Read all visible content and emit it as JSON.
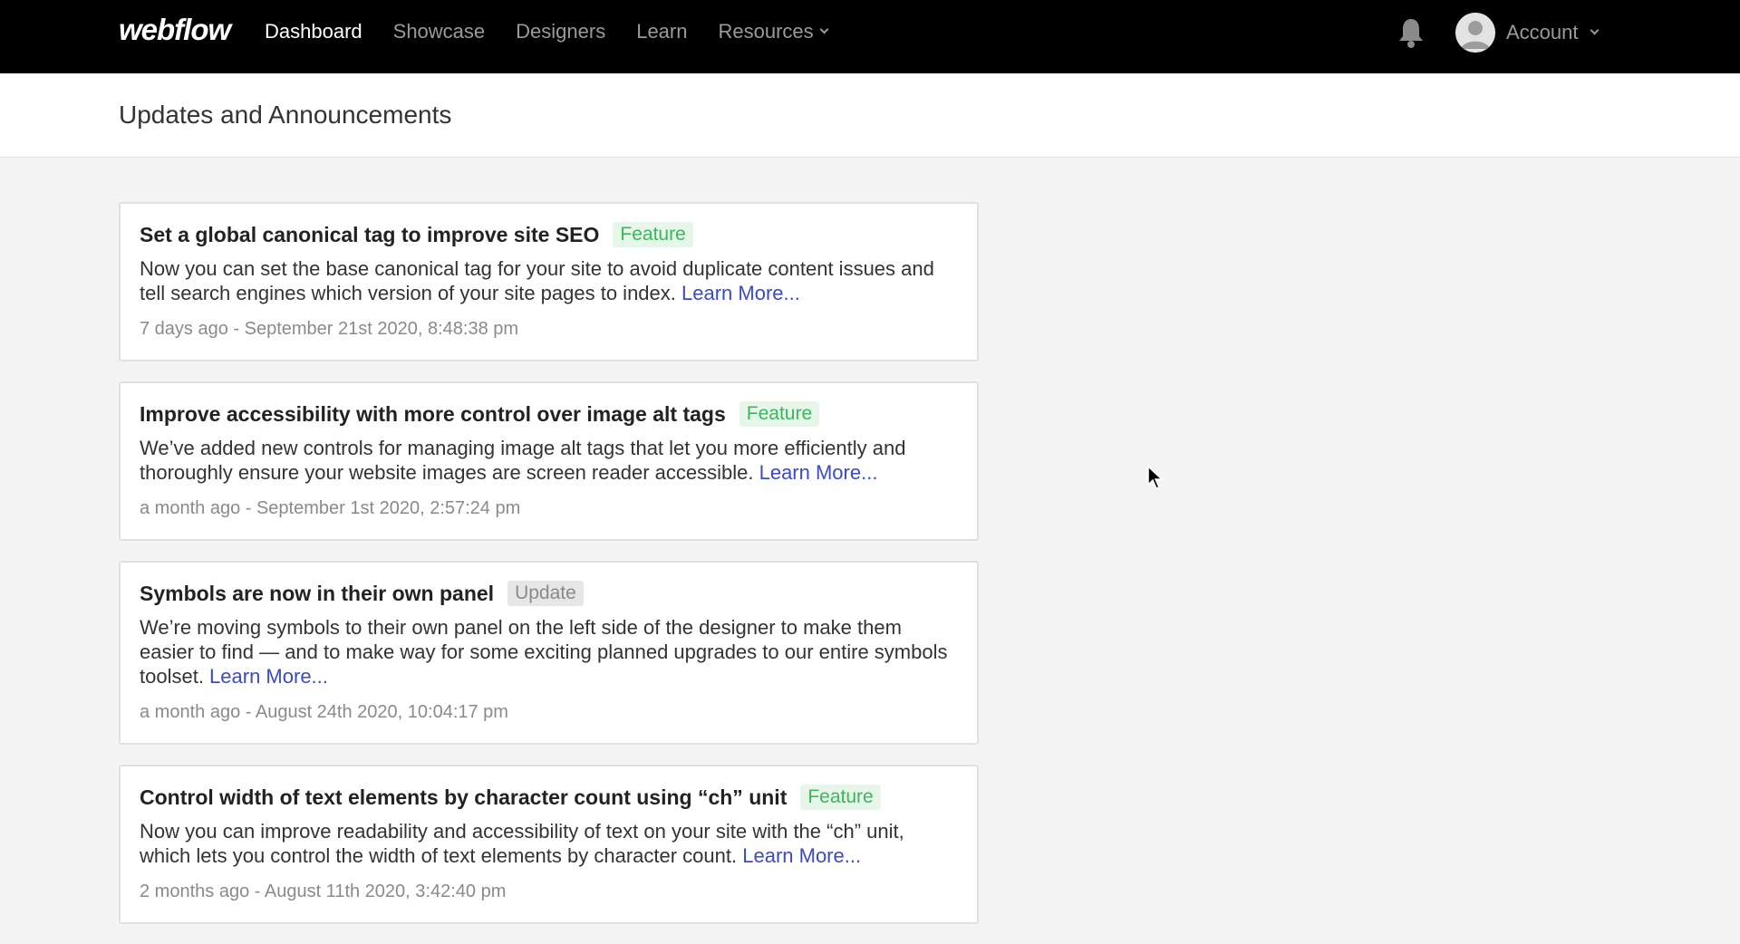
{
  "nav": {
    "logo": "webflow",
    "links": [
      {
        "label": "Dashboard",
        "active": true
      },
      {
        "label": "Showcase",
        "active": false
      },
      {
        "label": "Designers",
        "active": false
      },
      {
        "label": "Learn",
        "active": false
      },
      {
        "label": "Resources",
        "active": false,
        "has_dropdown": true
      }
    ],
    "bell_icon": "bell-icon",
    "account_label": "Account"
  },
  "header": {
    "title": "Updates and Announcements"
  },
  "announcements": [
    {
      "title": "Set a global canonical tag to improve site SEO",
      "badge": "Feature",
      "body": "Now you can set the base canonical tag for your site to avoid duplicate content issues and tell search engines which version of your site pages to index.",
      "link": "Learn More...",
      "date": "7 days ago - September 21st 2020, 8:48:38 pm"
    },
    {
      "title": "Improve accessibility with more control over image alt tags",
      "badge": "Feature",
      "body": "We’ve added new controls for managing image alt tags that let you more efficiently and thoroughly ensure your website images are screen reader accessible.",
      "link": "Learn More...",
      "date": "a month ago - September 1st 2020, 2:57:24 pm"
    },
    {
      "title": "Symbols are now in their own panel",
      "badge": "Update",
      "body": "We’re moving symbols to their own panel on the left side of the designer to make them easier to find — and to make way for some exciting planned upgrades to our entire symbols toolset.",
      "link": "Learn More...",
      "date": "a month ago - August 24th 2020, 10:04:17 pm"
    },
    {
      "title": "Control width of text elements by character count using “ch” unit",
      "badge": "Feature",
      "body": "Now you can improve readability and accessibility of text on your site with the “ch” unit, which lets you control the width of text elements by character count.",
      "link": "Learn More...",
      "date": "2 months ago - August 11th 2020, 3:42:40 pm"
    }
  ],
  "colors": {
    "nav_bg": "#000000",
    "feature_badge_text": "#3cb55e",
    "feature_badge_bg": "#e6f7ea",
    "update_badge_text": "#8a8a8a",
    "link": "#3a4bc4"
  }
}
